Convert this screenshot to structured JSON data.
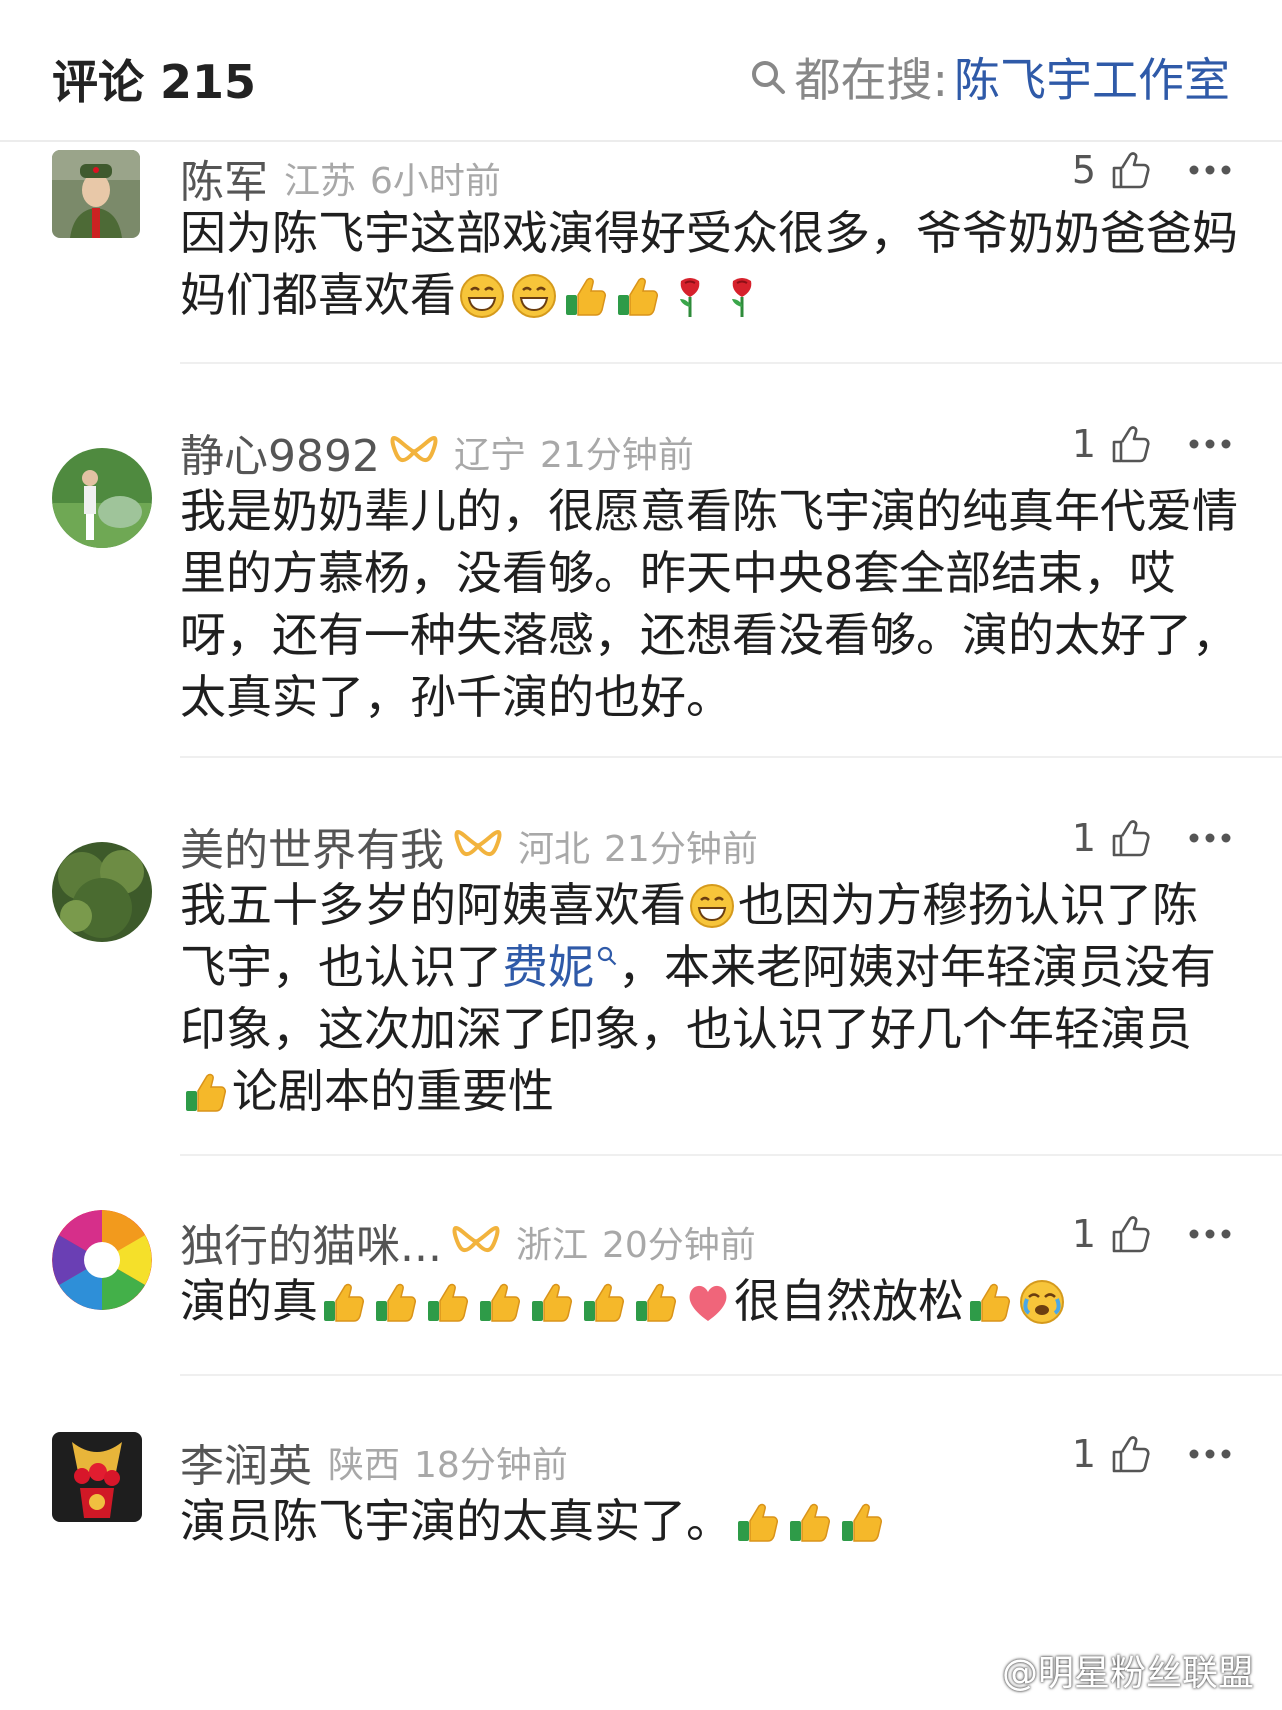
{
  "header": {
    "title": "评论 215",
    "search_prefix": "都在搜:",
    "search_hot": "陈飞宇工作室"
  },
  "comments": [
    {
      "name": "陈军",
      "location": "江苏",
      "time": "6小时前",
      "likes": "5",
      "text_parts": [
        "因为陈飞宇这部戏演得好受众很多，爷爷奶奶爸爸妈妈们都喜欢看"
      ],
      "emojis": [
        "grin-face",
        "grin-face",
        "thumbs-up",
        "thumbs-up",
        "rose",
        "rose"
      ]
    },
    {
      "name": "静心9892",
      "location": "辽宁",
      "time": "21分钟前",
      "likes": "1",
      "text_parts": [
        "我是奶奶辈儿的，很愿意看陈飞宇演的纯真年代爱情里的方慕杨，没看够。昨天中央8套全部结束，哎呀，还有一种失落感，还想看没看够。演的太好了，太真实了，孙千演的也好。"
      ]
    },
    {
      "name": "美的世界有我",
      "location": "河北",
      "time": "21分钟前",
      "likes": "1",
      "text_parts": [
        "我五十多岁的阿姨喜欢看",
        "也因为方穆扬认识了陈飞宇，也认识了",
        "费妮",
        "，本来老阿姨对年轻演员没有印象，这次加深了印象，也认识了好几个年轻演员",
        "论剧本的重要性"
      ]
    },
    {
      "name": "独行的猫咪...",
      "location": "浙江",
      "time": "20分钟前",
      "likes": "1",
      "text_parts": [
        "演的真",
        "很自然放松"
      ]
    },
    {
      "name": "李润英",
      "location": "陕西",
      "time": "18分钟前",
      "likes": "1",
      "text_parts": [
        "演员陈飞宇演的太真实了。"
      ]
    }
  ],
  "watermark": "@明星粉丝联盟",
  "colors": {
    "link": "#2f5aa8",
    "vip_badge": "#f2b33d",
    "meta_gray": "#a8a8a8"
  }
}
